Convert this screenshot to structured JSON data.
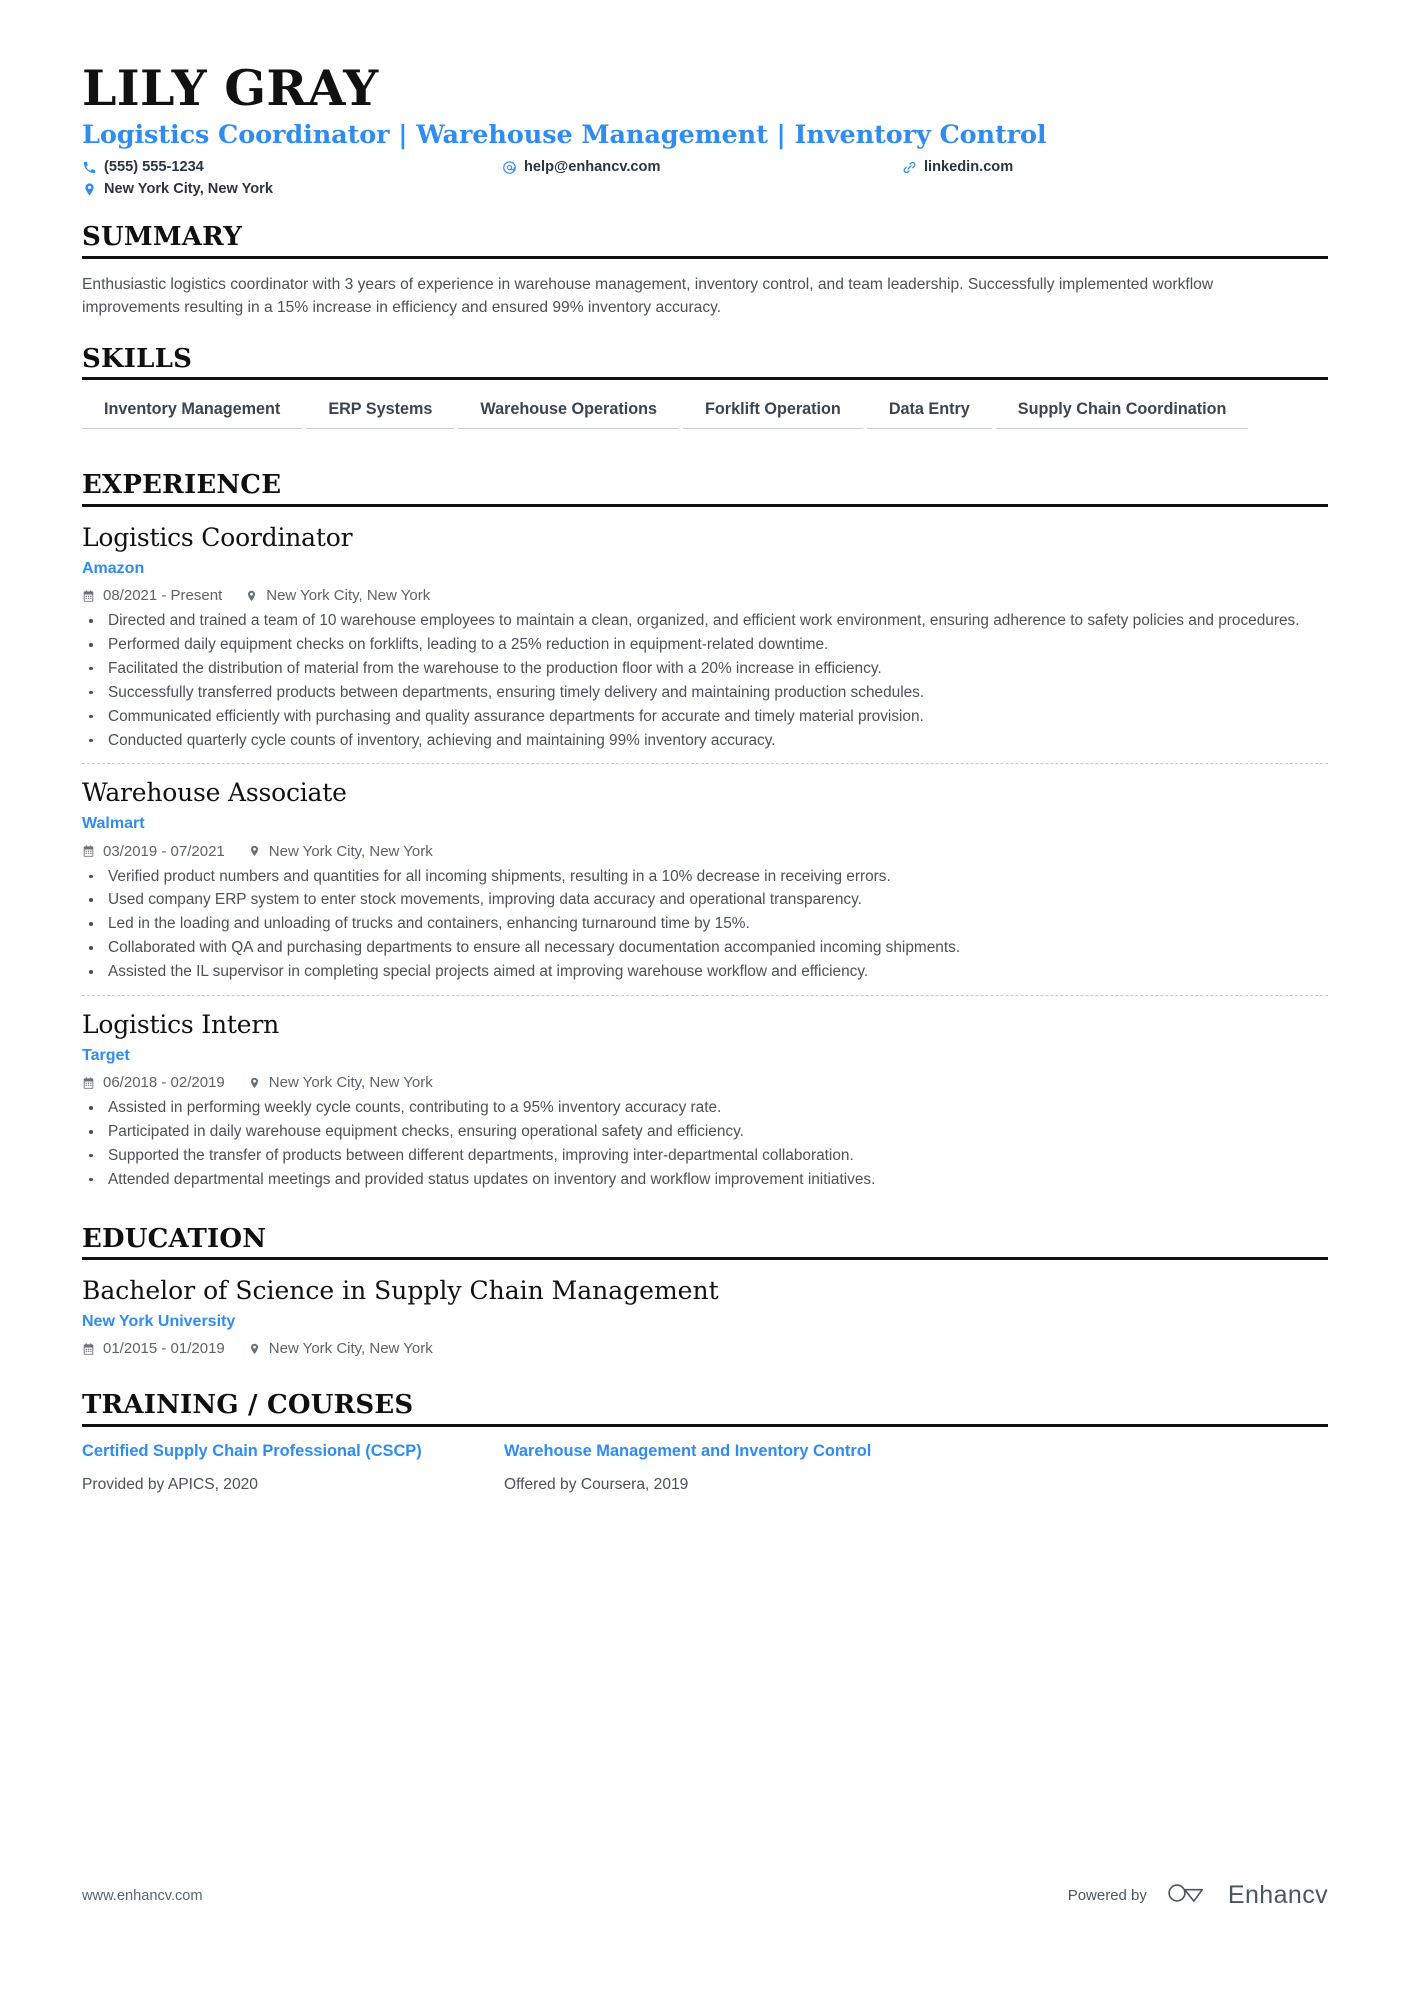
{
  "header": {
    "name": "LILY GRAY",
    "headline": "Logistics Coordinator | Warehouse Management | Inventory Control",
    "contacts": [
      {
        "icon": "phone-icon",
        "text": "(555) 555-1234"
      },
      {
        "icon": "email-icon",
        "text": "help@enhancv.com"
      },
      {
        "icon": "link-icon",
        "text": "linkedin.com"
      },
      {
        "icon": "location-icon",
        "text": "New York City, New York"
      }
    ]
  },
  "summary": {
    "title": "SUMMARY",
    "text": "Enthusiastic logistics coordinator with 3 years of experience in warehouse management, inventory control, and team leadership. Successfully implemented workflow improvements resulting in a 15% increase in efficiency and ensured 99% inventory accuracy."
  },
  "skills": {
    "title": "SKILLS",
    "items": [
      "Inventory Management",
      "ERP Systems",
      "Warehouse Operations",
      "Forklift Operation",
      "Data Entry",
      "Supply Chain Coordination"
    ]
  },
  "experience": {
    "title": "EXPERIENCE",
    "entries": [
      {
        "role": "Logistics Coordinator",
        "company": "Amazon",
        "dates": "08/2021 - Present",
        "location": "New York City, New York",
        "bullets": [
          "Directed and trained a team of 10 warehouse employees to maintain a clean, organized, and efficient work environment, ensuring adherence to safety policies and procedures.",
          "Performed daily equipment checks on forklifts, leading to a 25% reduction in equipment-related downtime.",
          "Facilitated the distribution of material from the warehouse to the production floor with a 20% increase in efficiency.",
          "Successfully transferred products between departments, ensuring timely delivery and maintaining production schedules.",
          "Communicated efficiently with purchasing and quality assurance departments for accurate and timely material provision.",
          "Conducted quarterly cycle counts of inventory, achieving and maintaining 99% inventory accuracy."
        ]
      },
      {
        "role": "Warehouse Associate",
        "company": "Walmart",
        "dates": "03/2019 - 07/2021",
        "location": "New York City, New York",
        "bullets": [
          "Verified product numbers and quantities for all incoming shipments, resulting in a 10% decrease in receiving errors.",
          "Used company ERP system to enter stock movements, improving data accuracy and operational transparency.",
          "Led in the loading and unloading of trucks and containers, enhancing turnaround time by 15%.",
          "Collaborated with QA and purchasing departments to ensure all necessary documentation accompanied incoming shipments.",
          "Assisted the IL supervisor in completing special projects aimed at improving warehouse workflow and efficiency."
        ]
      },
      {
        "role": "Logistics Intern",
        "company": "Target",
        "dates": "06/2018 - 02/2019",
        "location": "New York City, New York",
        "bullets": [
          "Assisted in performing weekly cycle counts, contributing to a 95% inventory accuracy rate.",
          "Participated in daily warehouse equipment checks, ensuring operational safety and efficiency.",
          "Supported the transfer of products between different departments, improving inter-departmental collaboration.",
          "Attended departmental meetings and provided status updates on inventory and workflow improvement initiatives."
        ]
      }
    ]
  },
  "education": {
    "title": "EDUCATION",
    "entries": [
      {
        "degree": "Bachelor of Science in Supply Chain Management",
        "school": "New York University",
        "dates": "01/2015 - 01/2019",
        "location": "New York City, New York"
      }
    ]
  },
  "training": {
    "title": "TRAINING / COURSES",
    "courses": [
      {
        "name": "Certified Supply Chain Professional (CSCP)",
        "provider": "Provided by APICS, 2020"
      },
      {
        "name": "Warehouse Management and Inventory Control",
        "provider": "Offered by Coursera, 2019"
      }
    ]
  },
  "footer": {
    "url": "www.enhancv.com",
    "powered_by": "Powered by",
    "brand": "Enhancv"
  },
  "colors": {
    "accent": "#2f8cf0",
    "text": "#4a5159",
    "heading": "#111111"
  }
}
